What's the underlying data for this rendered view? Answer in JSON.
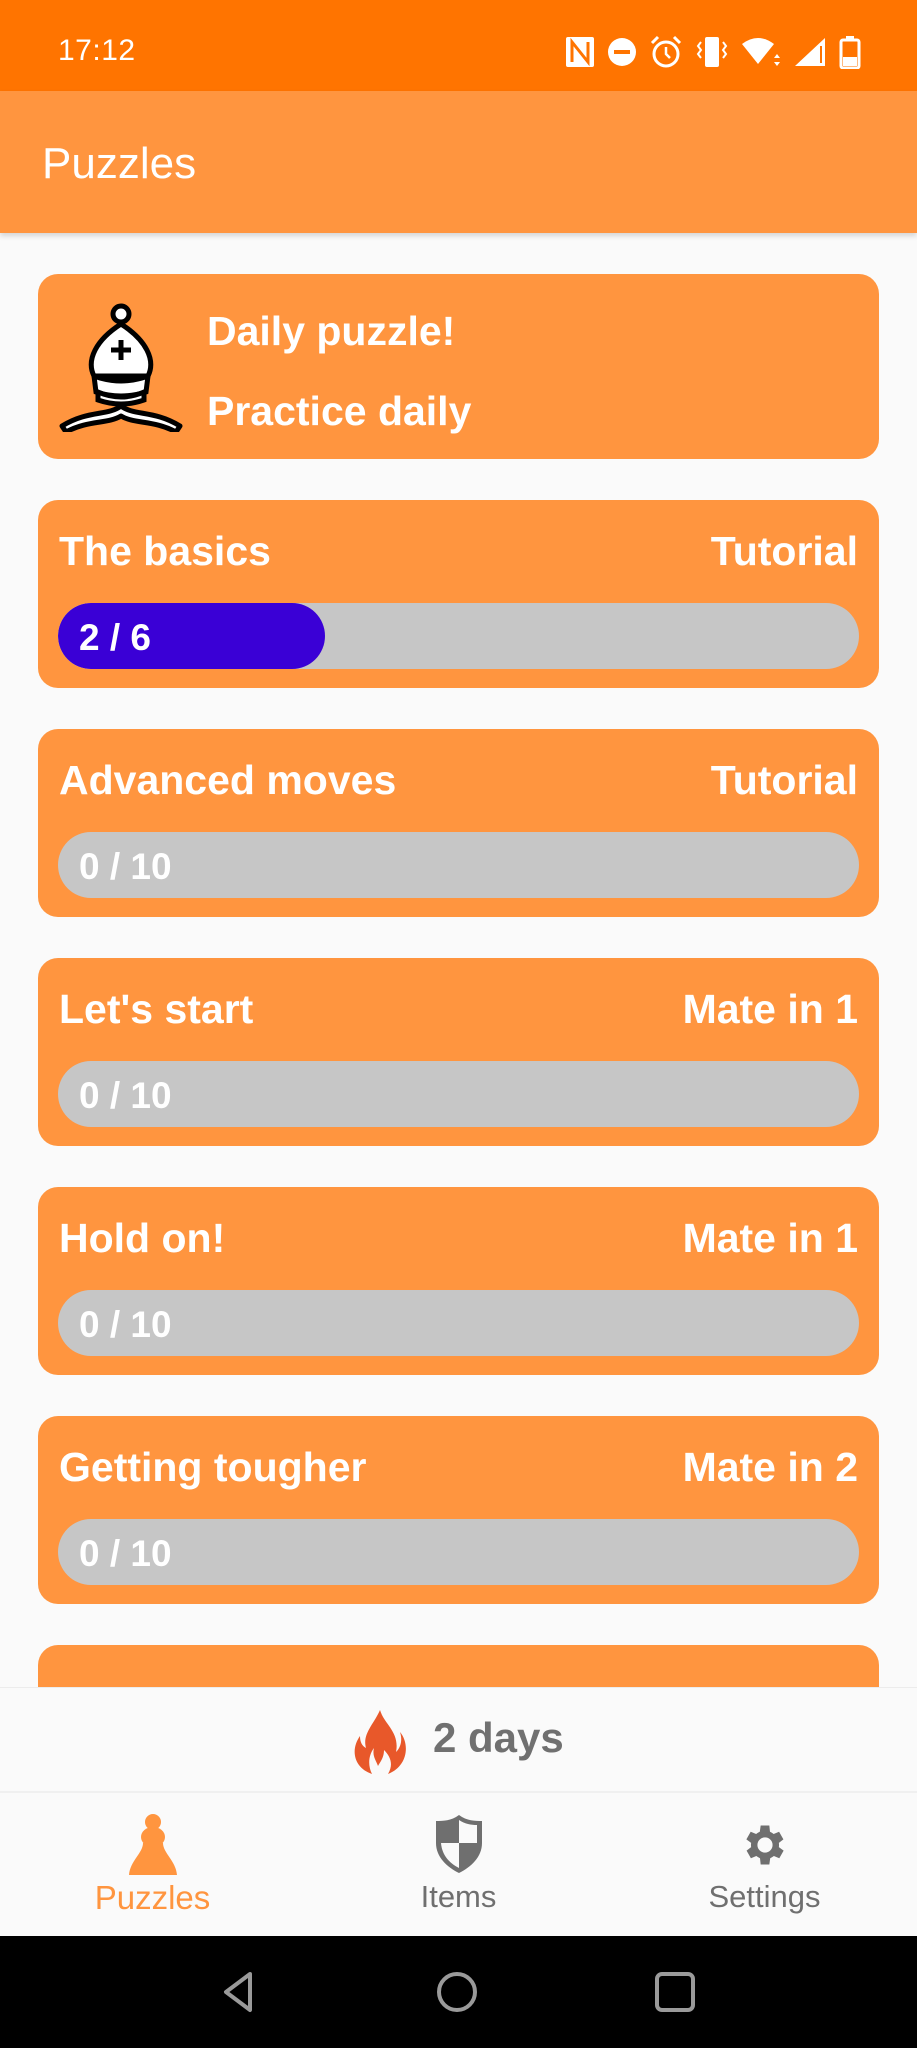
{
  "status_bar": {
    "time": "17:12",
    "icons": [
      "nfc-icon",
      "do-not-disturb-icon",
      "alarm-icon",
      "vibrate-icon",
      "wifi-icon",
      "cell-signal-icon",
      "battery-icon"
    ]
  },
  "app_bar": {
    "title": "Puzzles"
  },
  "daily": {
    "icon": "chess-bishop-icon",
    "title": "Daily puzzle!",
    "subtitle": "Practice daily"
  },
  "puzzles": [
    {
      "title": "The basics",
      "type": "Tutorial",
      "solved": 2,
      "total": 6,
      "progress_label": "2 / 6"
    },
    {
      "title": "Advanced moves",
      "type": "Tutorial",
      "solved": 0,
      "total": 10,
      "progress_label": "0 / 10"
    },
    {
      "title": "Let's start",
      "type": "Mate in 1",
      "solved": 0,
      "total": 10,
      "progress_label": "0 / 10"
    },
    {
      "title": "Hold on!",
      "type": "Mate in 1",
      "solved": 0,
      "total": 10,
      "progress_label": "0 / 10"
    },
    {
      "title": "Getting tougher",
      "type": "Mate in 2",
      "solved": 0,
      "total": 10,
      "progress_label": "0 / 10"
    }
  ],
  "streak": {
    "icon": "flame-icon",
    "label": "2 days",
    "color": "#e8582a"
  },
  "bottom_nav": {
    "items": [
      {
        "label": "Puzzles",
        "icon": "chess-pawn-icon",
        "active": true
      },
      {
        "label": "Items",
        "icon": "shield-icon",
        "active": false
      },
      {
        "label": "Settings",
        "icon": "gear-icon",
        "active": false
      }
    ]
  },
  "colors": {
    "status_bar": "#ff7400",
    "accent": "#ff953f",
    "progress_fill": "#3a00d6",
    "progress_track": "#c6c6c6",
    "inactive_nav": "#6f6f6f"
  }
}
